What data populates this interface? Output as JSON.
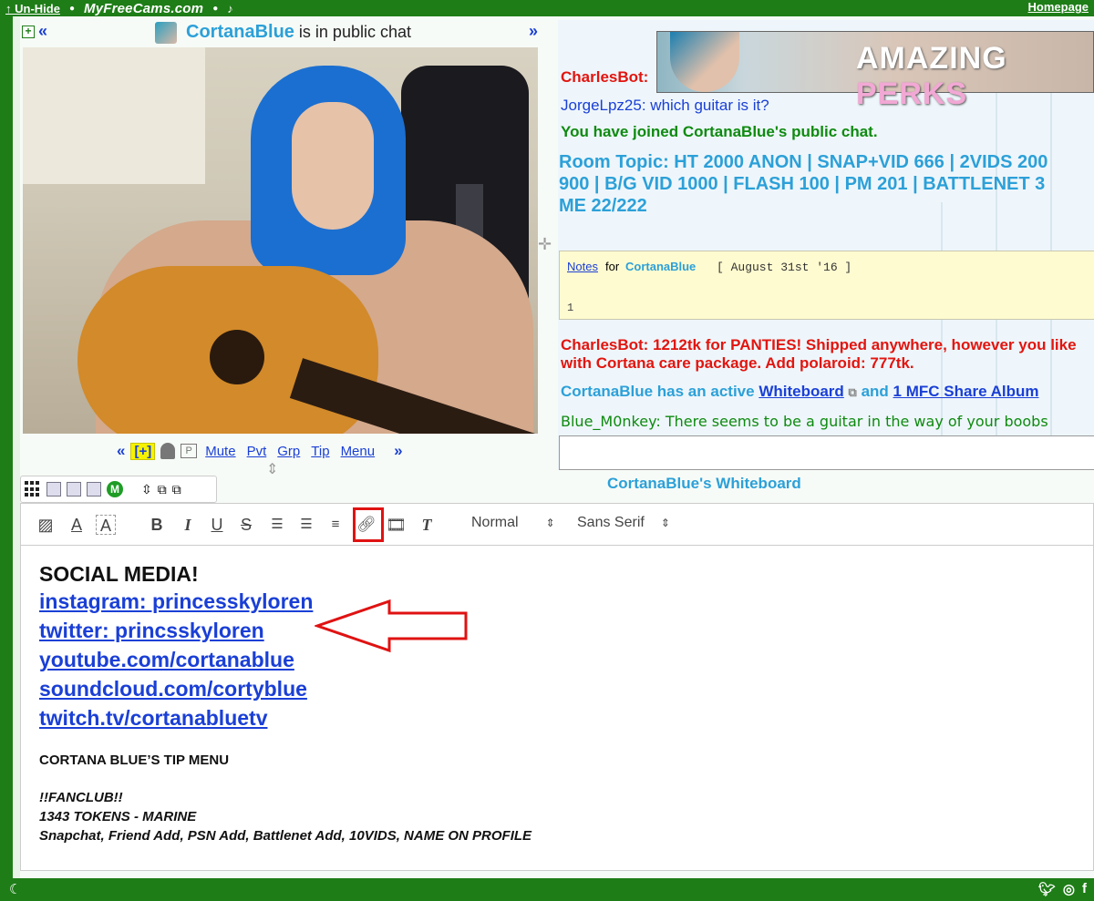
{
  "topbar": {
    "unhide": "↑ Un-Hide",
    "brand": "MyFreeCams.com",
    "homepage": "Homepage"
  },
  "cam": {
    "expand_icon": "+",
    "prev": "«",
    "next": "»",
    "model_name": "CortanaBlue",
    "status_text": "is in public chat",
    "controls": {
      "prev": "«",
      "plus_label": "[+]",
      "mute": "Mute",
      "pvt": "Pvt",
      "grp": "Grp",
      "tip": "Tip",
      "menu": "Menu",
      "next": "»"
    }
  },
  "chat": {
    "banner_text_1": "AMAZING",
    "banner_text_2": "PERKS",
    "lines": [
      {
        "text": "CharlesBot:"
      },
      {
        "text": "JorgeLpz25: which guitar is it?"
      },
      {
        "text": "You have joined CortanaBlue's public chat."
      }
    ],
    "topic_lines": [
      "Room Topic: HT 2000 ANON | SNAP+VID 666 | 2VIDS 200",
      "900 | B/G VID 1000 | FLASH 100 | PM 201 | BATTLENET 3",
      "ME 22/222"
    ],
    "notes": {
      "link": "Notes",
      "for": "for",
      "name": "CortanaBlue",
      "date": "[ August 31st '16 ]",
      "count": "1"
    },
    "bot_line_1": "CharlesBot: 1212tk for PANTIES! Shipped anywhere, however you like",
    "bot_line_2": "with Cortana care package. Add polaroid: 777tk.",
    "whiteboard_prefix": "CortanaBlue has an active",
    "whiteboard_link": "Whiteboard",
    "and": "and",
    "album_link": "1 MFC Share Album",
    "user_msg": "Blue_M0nkey: There seems to be a guitar in the way of your boobs"
  },
  "whiteboard": {
    "title": "CortanaBlue's Whiteboard",
    "mini_m": "M",
    "toolbar": {
      "text_color": "A",
      "highlight": "A",
      "bold": "B",
      "italic": "I",
      "underline": "U",
      "strike": "S",
      "size_select": "Normal",
      "font_select": "Sans Serif"
    },
    "heading": "SOCIAL MEDIA!",
    "links": [
      "instagram: princesskyloren",
      "twitter: princsskyloren ",
      "youtube.com/cortanablue",
      "soundcloud.com/cortyblue",
      "twitch.tv/cortanabluetv"
    ],
    "tip_menu_title": "CORTANA BLUE’S TIP MENU",
    "fanclub_lines": [
      "!!FANCLUB!!",
      "1343 TOKENS - MARINE",
      "Snapchat, Friend Add, PSN Add, Battlenet Add, 10VIDS, NAME ON PROFILE"
    ]
  },
  "colors": {
    "green_bar": "#1e7d17",
    "link_blue": "#1a3fd6",
    "name_blue": "#2ca0d8",
    "bot_red": "#e2150f",
    "annotation_red": "#e01212"
  }
}
